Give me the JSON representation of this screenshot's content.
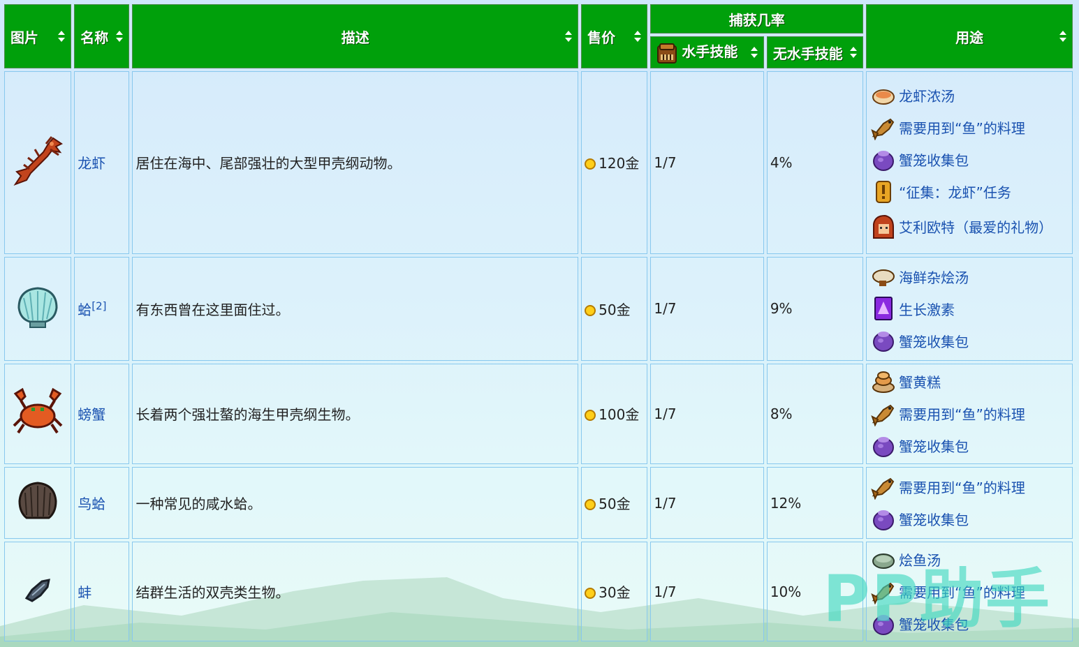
{
  "headers": {
    "image": "图片",
    "name": "名称",
    "description": "描述",
    "price": "售价",
    "catch_rate": "捕获几率",
    "mariner": "水手技能",
    "no_mariner": "无水手技能",
    "uses": "用途"
  },
  "rows": [
    {
      "icon": "lobster-icon",
      "name": "龙虾",
      "sup": "",
      "description": "居住在海中、尾部强壮的大型甲壳纲动物。",
      "price": "120金",
      "mariner": "1/7",
      "no_mariner": "4%",
      "uses": [
        {
          "icon": "lobster-bisque-icon",
          "text": "龙虾浓汤"
        },
        {
          "icon": "fish-icon",
          "text": "需要用到“鱼”的料理"
        },
        {
          "icon": "crab-pot-bundle-icon",
          "text": "蟹笼收集包"
        },
        {
          "icon": "quest-icon",
          "text": "“征集：龙虾”任务"
        },
        {
          "icon": "elliott-icon",
          "text": "艾利欧特（最爱的礼物）"
        }
      ]
    },
    {
      "icon": "clam-icon",
      "name": "蛤",
      "sup": "[2]",
      "description": "有东西曾在这里面住过。",
      "price": "50金",
      "mariner": "1/7",
      "no_mariner": "9%",
      "uses": [
        {
          "icon": "chowder-icon",
          "text": "海鲜杂烩汤"
        },
        {
          "icon": "growth-hormone-icon",
          "text": "生长激素"
        },
        {
          "icon": "crab-pot-bundle-icon",
          "text": "蟹笼收集包"
        }
      ]
    },
    {
      "icon": "crab-icon",
      "name": "螃蟹",
      "sup": "",
      "description": "长着两个强壮螯的海生甲壳纲生物。",
      "price": "100金",
      "mariner": "1/7",
      "no_mariner": "8%",
      "uses": [
        {
          "icon": "crab-cakes-icon",
          "text": "蟹黄糕"
        },
        {
          "icon": "fish-icon",
          "text": "需要用到“鱼”的料理"
        },
        {
          "icon": "crab-pot-bundle-icon",
          "text": "蟹笼收集包"
        }
      ]
    },
    {
      "icon": "cockle-icon",
      "name": "鸟蛤",
      "sup": "",
      "description": "一种常见的咸水蛤。",
      "price": "50金",
      "mariner": "1/7",
      "no_mariner": "12%",
      "uses": [
        {
          "icon": "fish-icon",
          "text": "需要用到“鱼”的料理"
        },
        {
          "icon": "crab-pot-bundle-icon",
          "text": "蟹笼收集包"
        }
      ]
    },
    {
      "icon": "mussel-icon",
      "name": "蚌",
      "sup": "",
      "description": "结群生活的双壳类生物。",
      "price": "30金",
      "mariner": "1/7",
      "no_mariner": "10%",
      "uses": [
        {
          "icon": "fish-stew-icon",
          "text": "烩鱼汤"
        },
        {
          "icon": "fish-icon",
          "text": "需要用到“鱼”的料理"
        },
        {
          "icon": "crab-pot-bundle-icon",
          "text": "蟹笼收集包"
        }
      ]
    }
  ],
  "watermark": "PP助手",
  "colors": {
    "header_bg": "#00a00b",
    "link": "#1a52b0",
    "coin": "#ffcf1a",
    "watermark": "#3cd7be"
  }
}
